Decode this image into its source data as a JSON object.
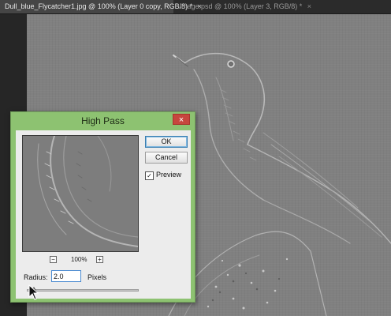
{
  "tabs": [
    {
      "label": "Dull_blue_Flycatcher1.jpg @ 100% (Layer 0 copy, RGB/8) *",
      "close": "×",
      "active": true
    },
    {
      "label": "image.psd @ 100% (Layer 3, RGB/8) *",
      "close": "×",
      "active": false
    }
  ],
  "dialog": {
    "title": "High Pass",
    "close_glyph": "×",
    "ok_label": "OK",
    "cancel_label": "Cancel",
    "preview_label": "Preview",
    "preview_checked": true,
    "zoom_out": "−",
    "zoom_in": "+",
    "zoom_level": "100%",
    "radius_label": "Radius:",
    "radius_value": "2.0",
    "radius_units": "Pixels",
    "slider_fraction": 0.06
  },
  "colors": {
    "dialog_frame": "#8dc271",
    "close_button": "#c7463e",
    "canvas_gray": "#808080"
  },
  "icons": [
    "close-icon",
    "checkmark-icon",
    "zoom-out-icon",
    "zoom-in-icon",
    "slider-thumb-icon",
    "arrow-cursor-icon"
  ]
}
